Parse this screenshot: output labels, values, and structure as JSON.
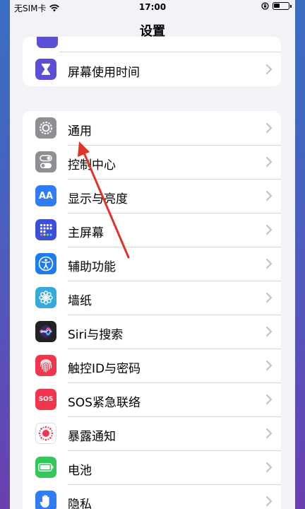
{
  "status": {
    "carrier": "无SIM卡",
    "time": "17:00"
  },
  "nav": {
    "title": "设置"
  },
  "group1": {
    "items": [
      {
        "label": "屏幕使用时间",
        "icon": "hourglass-icon",
        "color": "#5b4fd6"
      }
    ]
  },
  "group2": {
    "items": [
      {
        "label": "通用",
        "icon": "gear-icon",
        "color": "#8e8e93"
      },
      {
        "label": "控制中心",
        "icon": "toggles-icon",
        "color": "#8e8e93"
      },
      {
        "label": "显示与亮度",
        "icon": "aa-icon",
        "color": "#2f7cf6",
        "glyph": "AA"
      },
      {
        "label": "主屏幕",
        "icon": "grid-icon",
        "color": "#3a50d9"
      },
      {
        "label": "辅助功能",
        "icon": "accessibility-icon",
        "color": "#1d7cf2"
      },
      {
        "label": "墙纸",
        "icon": "flower-icon",
        "color": "#36aadc"
      },
      {
        "label": "Siri与搜索",
        "icon": "siri-icon",
        "color": "#222222"
      },
      {
        "label": "触控ID与密码",
        "icon": "fingerprint-icon",
        "color": "#f0364f"
      },
      {
        "label": "SOS紧急联络",
        "icon": "sos-icon",
        "color": "#f0364f",
        "glyph": "SOS"
      },
      {
        "label": "暴露通知",
        "icon": "exposure-icon",
        "color": "#ffffff"
      },
      {
        "label": "电池",
        "icon": "battery-setting-icon",
        "color": "#34c759"
      },
      {
        "label": "隐私",
        "icon": "hand-icon",
        "color": "#2f7cf6"
      }
    ]
  },
  "annotation": {
    "color": "#e0342a"
  }
}
